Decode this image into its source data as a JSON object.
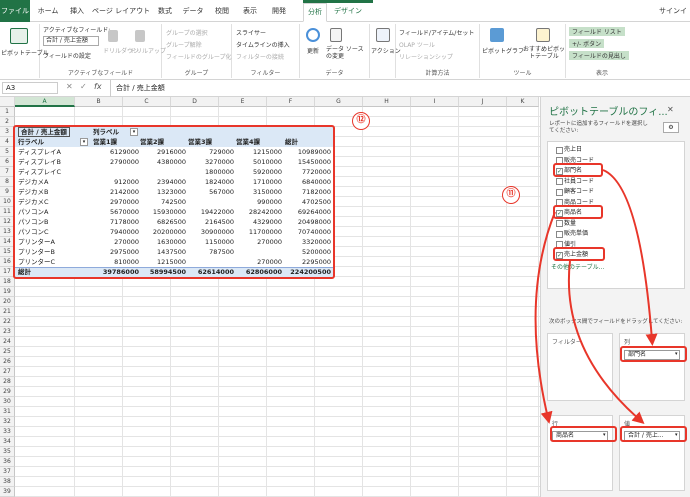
{
  "app": {
    "user_label": "サインイ"
  },
  "tabs": [
    "ファイル",
    "ホーム",
    "挿入",
    "ページ レイアウト",
    "数式",
    "データ",
    "校閲",
    "表示",
    "開発",
    "分析",
    "デザイン"
  ],
  "ribbon": {
    "pivot_button": "ピボットテーブル",
    "active_field_label": "アクティブなフィールド:",
    "active_field_value": "合計 / 売上金額",
    "field_settings": "フィールドの設定",
    "drill_down": "ドリルダウン",
    "drill_up": "ドリルアップ",
    "group_selection": "グループの選択",
    "ungroup": "グループ解除",
    "group_field": "フィールドのグループ化",
    "slicer": "スライサー",
    "timeline": "タイムラインの挿入",
    "filter_conn": "フィルターの接続",
    "refresh": "更新",
    "change_source": "データ ソースの変更",
    "actions": "アクション",
    "fields_items": "フィールド/アイテム/セット",
    "olap_tools": "OLAP ツール",
    "relationships": "リレーションシップ",
    "pivot_chart": "ピボットグラフ",
    "recommended": "おすすめピボットテーブル",
    "field_list": "フィールド リスト",
    "plus_minus": "+/- ボタン",
    "field_headers": "フィールドの見出し",
    "group_labels": [
      "アクティブなフィールド",
      "グループ",
      "フィルター",
      "データ",
      "計算方法",
      "ツール",
      "表示"
    ]
  },
  "formula_bar": {
    "name_box": "A3",
    "fx": "fx",
    "content": "合計 / 売上金額"
  },
  "columns": [
    "A",
    "B",
    "C",
    "D",
    "E",
    "F",
    "G",
    "H",
    "I",
    "J",
    "K"
  ],
  "pivot": {
    "corner": "合計 / 売上金額",
    "col_label": "列ラベル",
    "row_label": "行ラベル",
    "col_headers": [
      "営業1課",
      "営業2課",
      "営業3課",
      "営業4課",
      "総計"
    ],
    "rows": [
      {
        "label": "ディスプレイA",
        "values": [
          "6129000",
          "2916000",
          "729000",
          "1215000",
          "10989000"
        ]
      },
      {
        "label": "ディスプレイB",
        "values": [
          "2790000",
          "4380000",
          "3270000",
          "5010000",
          "15450000"
        ]
      },
      {
        "label": "ディスプレイC",
        "values": [
          "",
          "",
          "1800000",
          "5920000",
          "7720000"
        ]
      },
      {
        "label": "デジカメA",
        "values": [
          "912000",
          "2394000",
          "1824000",
          "1710000",
          "6840000"
        ]
      },
      {
        "label": "デジカメB",
        "values": [
          "2142000",
          "1323000",
          "567000",
          "3150000",
          "7182000"
        ]
      },
      {
        "label": "デジカメC",
        "values": [
          "2970000",
          "742500",
          "",
          "990000",
          "4702500"
        ]
      },
      {
        "label": "パソコンA",
        "values": [
          "5670000",
          "15930000",
          "19422000",
          "28242000",
          "69264000"
        ]
      },
      {
        "label": "パソコンB",
        "values": [
          "7178000",
          "6826500",
          "2164500",
          "4329000",
          "20498000"
        ]
      },
      {
        "label": "パソコンC",
        "values": [
          "7940000",
          "20200000",
          "30900000",
          "11700000",
          "70740000"
        ]
      },
      {
        "label": "プリンターA",
        "values": [
          "270000",
          "1630000",
          "1150000",
          "270000",
          "3320000"
        ]
      },
      {
        "label": "プリンターB",
        "values": [
          "2975000",
          "1437500",
          "787500",
          "",
          "5200000"
        ]
      },
      {
        "label": "プリンターC",
        "values": [
          "810000",
          "1215000",
          "",
          "270000",
          "2295000"
        ]
      }
    ],
    "total_label": "総計",
    "totals": [
      "39786000",
      "58994500",
      "62614000",
      "62806000",
      "224200500"
    ]
  },
  "pane": {
    "title": "ピボットテーブルのフィ...",
    "desc": "レポートに追加するフィールドを選択してください:",
    "fields": [
      {
        "name": "売上日",
        "checked": false
      },
      {
        "name": "販売コード",
        "checked": false
      },
      {
        "name": "部門名",
        "checked": true
      },
      {
        "name": "社員コード",
        "checked": false
      },
      {
        "name": "顧客コード",
        "checked": false
      },
      {
        "name": "商品コード",
        "checked": false
      },
      {
        "name": "商品名",
        "checked": true
      },
      {
        "name": "数量",
        "checked": false
      },
      {
        "name": "販売単価",
        "checked": false
      },
      {
        "name": "値引",
        "checked": false
      },
      {
        "name": "売上金額",
        "checked": true
      }
    ],
    "more_tables": "その他のテーブル...",
    "drag_hint": "次のボックス間でフィールドをドラッグしてください:",
    "filter_area": "フィルター",
    "col_area": "列",
    "row_area": "行",
    "val_area": "値",
    "col_pill": "部門名",
    "row_pill": "商品名",
    "val_pill": "合計 / 売上..."
  },
  "callouts": {
    "c11": "⑪",
    "c12": "⑫"
  },
  "colors": {
    "accent": "#217346",
    "callout": "#e8362a"
  }
}
